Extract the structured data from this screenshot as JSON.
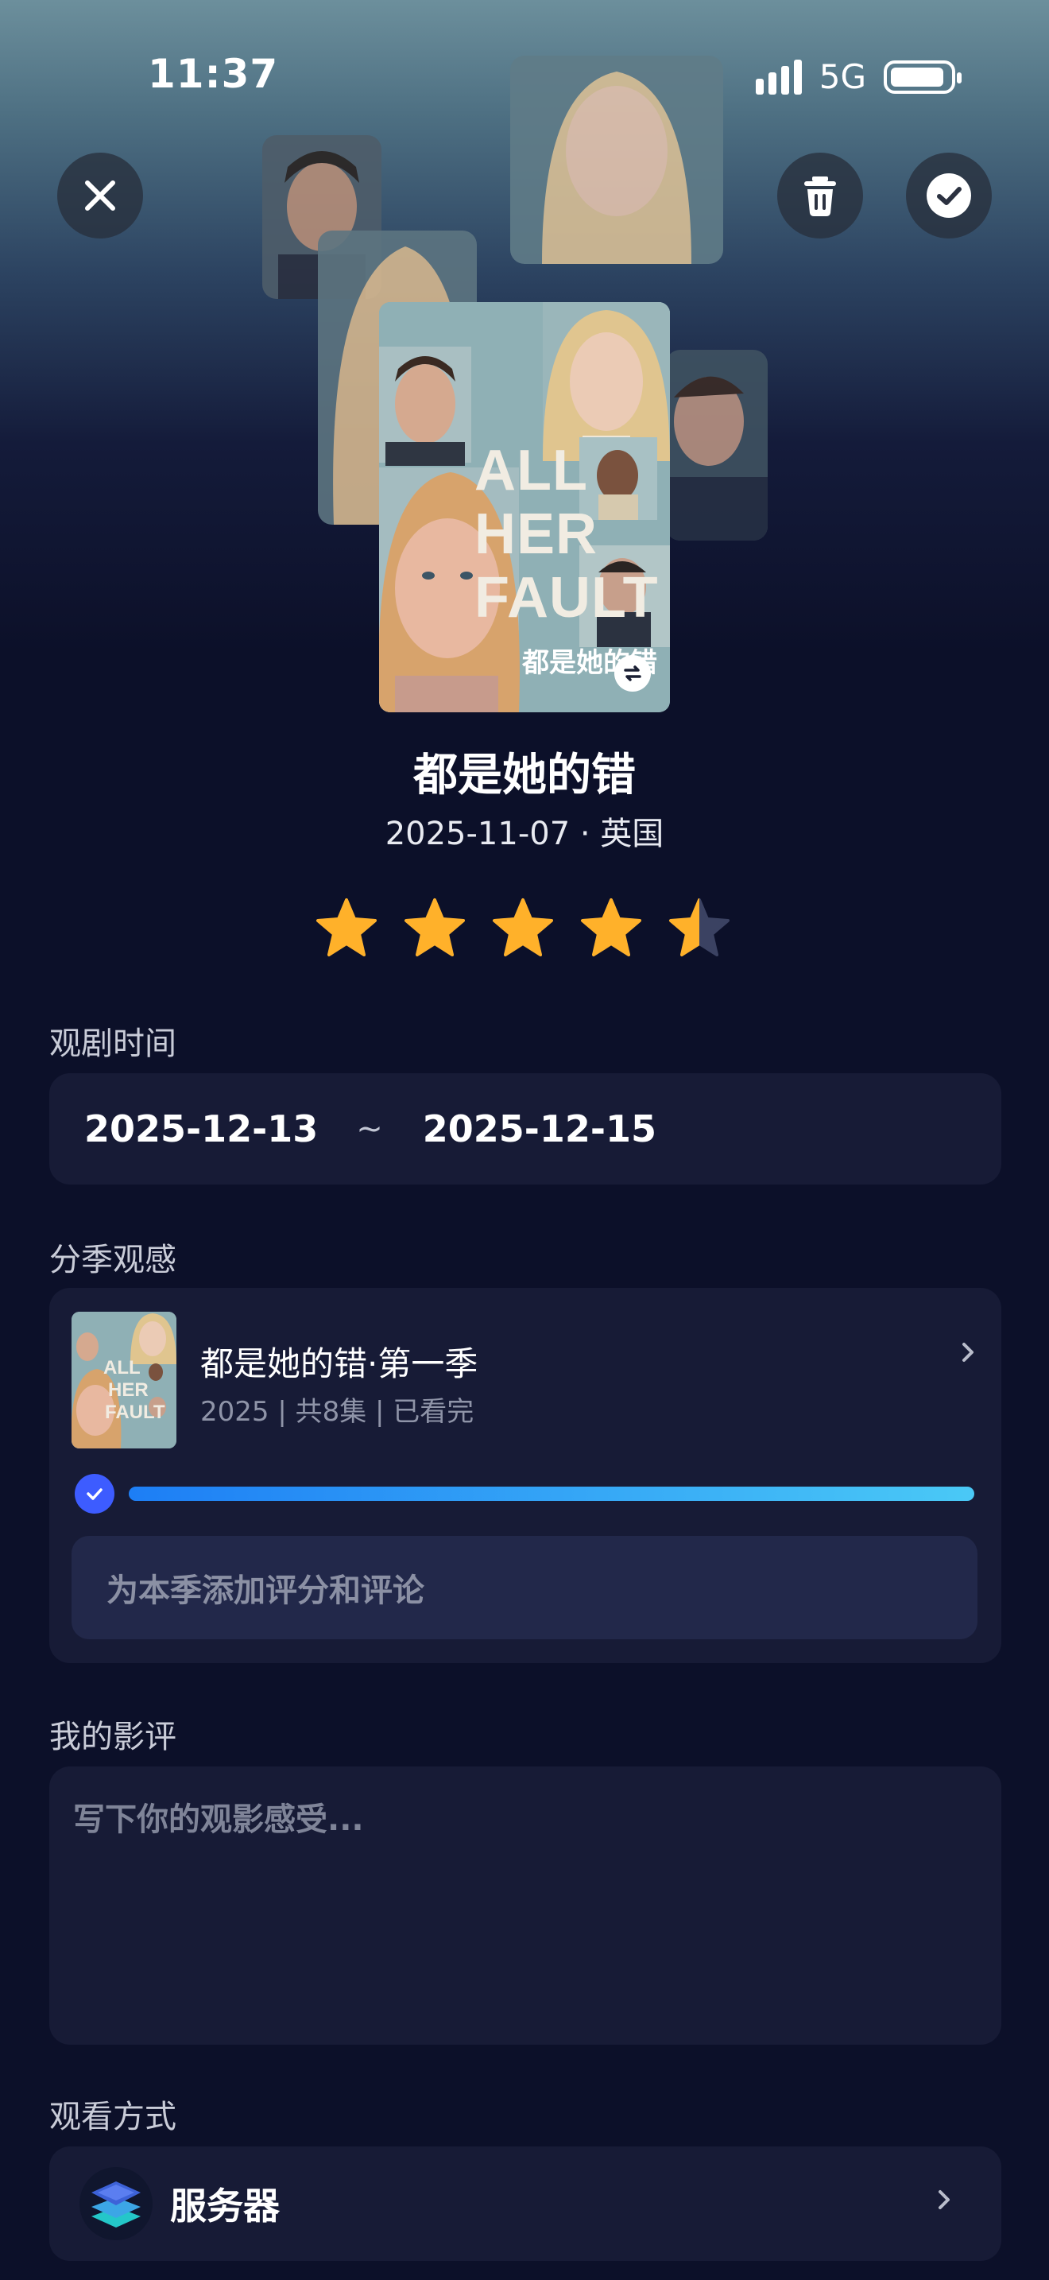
{
  "status_bar": {
    "time": "11:37",
    "network": "5G"
  },
  "top_actions": {
    "close": "close-icon",
    "delete": "trash-icon",
    "confirm": "check-circle-icon"
  },
  "poster": {
    "title_lines": [
      "ALL",
      "HER",
      "FAULT"
    ],
    "cn_title": "都是她的错",
    "swap_icon": "swap-icon"
  },
  "show": {
    "title": "都是她的错",
    "subtitle": "2025-11-07 · 英国",
    "rating": 4.5,
    "rating_max": 5
  },
  "colors": {
    "background": "#0c1029",
    "card": "#171b36",
    "star": "#ffb12a",
    "accent": "#3d5cff"
  },
  "watch_period": {
    "label": "观剧时间",
    "start": "2025-12-13",
    "separator": "~",
    "end": "2025-12-15"
  },
  "seasons": {
    "label": "分季观感",
    "items": [
      {
        "name": "都是她的错·第一季",
        "meta": "2025 | 共8集 | 已看完",
        "progress": 1.0,
        "add_review_label": "为本季添加评分和评论"
      }
    ]
  },
  "review": {
    "label": "我的影评",
    "placeholder": "写下你的观影感受..."
  },
  "watch_method": {
    "label": "观看方式",
    "value": "服务器",
    "icon": "server-stack-icon"
  }
}
